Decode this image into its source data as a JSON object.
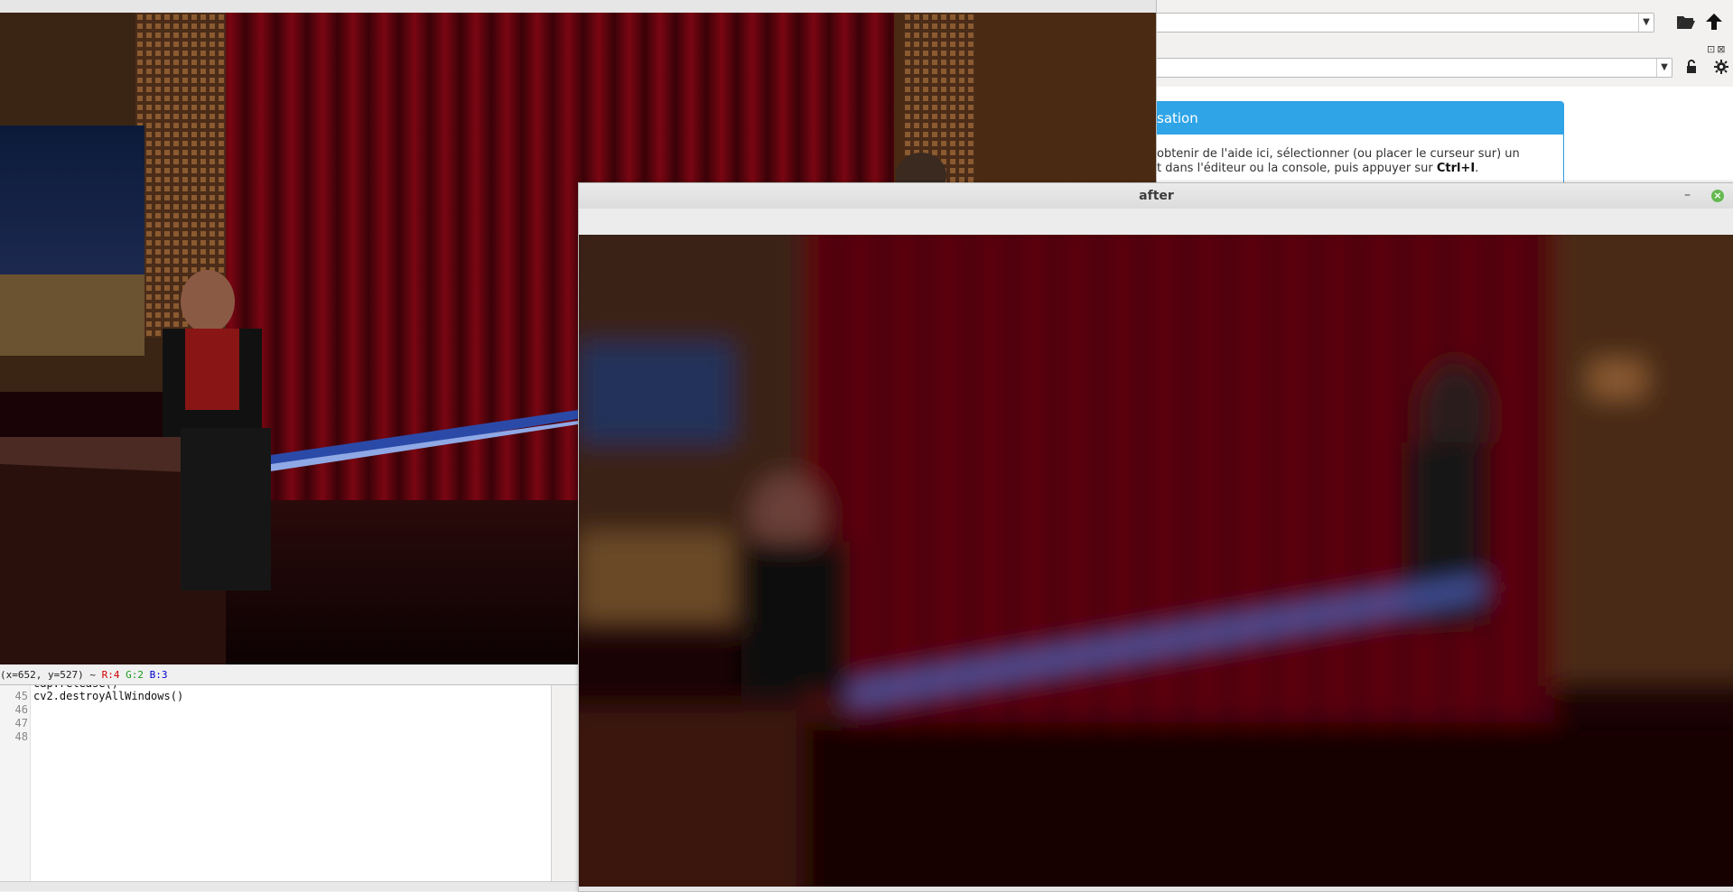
{
  "ide": {
    "help": {
      "title": "sation",
      "line1": "obtenir de l'aide ici, sélectionner (ou placer le curseur sur) un",
      "line2_prefix": "t dans l'éditeur ou la console, puis appuyer sur ",
      "line2_key": "Ctrl+I",
      "line2_suffix": "."
    },
    "toolbar": {
      "browse_icon": "folder-open-icon",
      "parent_icon": "arrow-up-icon",
      "lock_icon": "unlock-icon",
      "options_icon": "gear-icon"
    },
    "editor": {
      "lines": [
        {
          "num": "",
          "code": "cap.release()"
        },
        {
          "num": "45",
          "code": "cv2.destroyAllWindows()"
        },
        {
          "num": "46",
          "code": ""
        },
        {
          "num": "47",
          "code": ""
        },
        {
          "num": "48",
          "code": ""
        }
      ]
    }
  },
  "before_window": {
    "status": {
      "coords": "(x=652, y=527) ~",
      "r": "R:4",
      "g": "G:2",
      "b": "B:3"
    }
  },
  "after_window": {
    "title": "after",
    "min_symbol": "–",
    "close_symbol": "×"
  }
}
